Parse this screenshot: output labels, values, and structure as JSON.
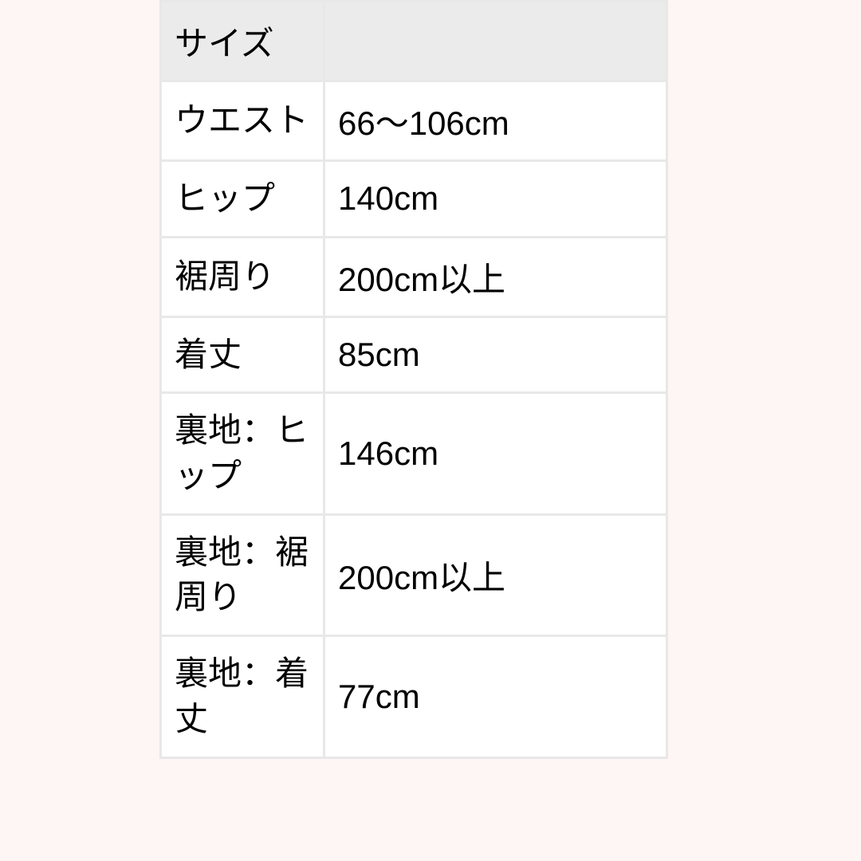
{
  "table": {
    "header": {
      "label": "サイズ",
      "empty": ""
    },
    "rows": [
      {
        "label": "ウエスト",
        "value": "66〜106cm"
      },
      {
        "label": "ヒップ",
        "value": "140cm"
      },
      {
        "label": "裾周り",
        "value": "200cm以上"
      },
      {
        "label": "着丈",
        "value": "85cm"
      },
      {
        "label": "裏地：ヒップ",
        "value": "146cm"
      },
      {
        "label": "裏地：裾周り",
        "value": "200cm以上"
      },
      {
        "label": "裏地：着丈",
        "value": "77cm"
      }
    ]
  }
}
